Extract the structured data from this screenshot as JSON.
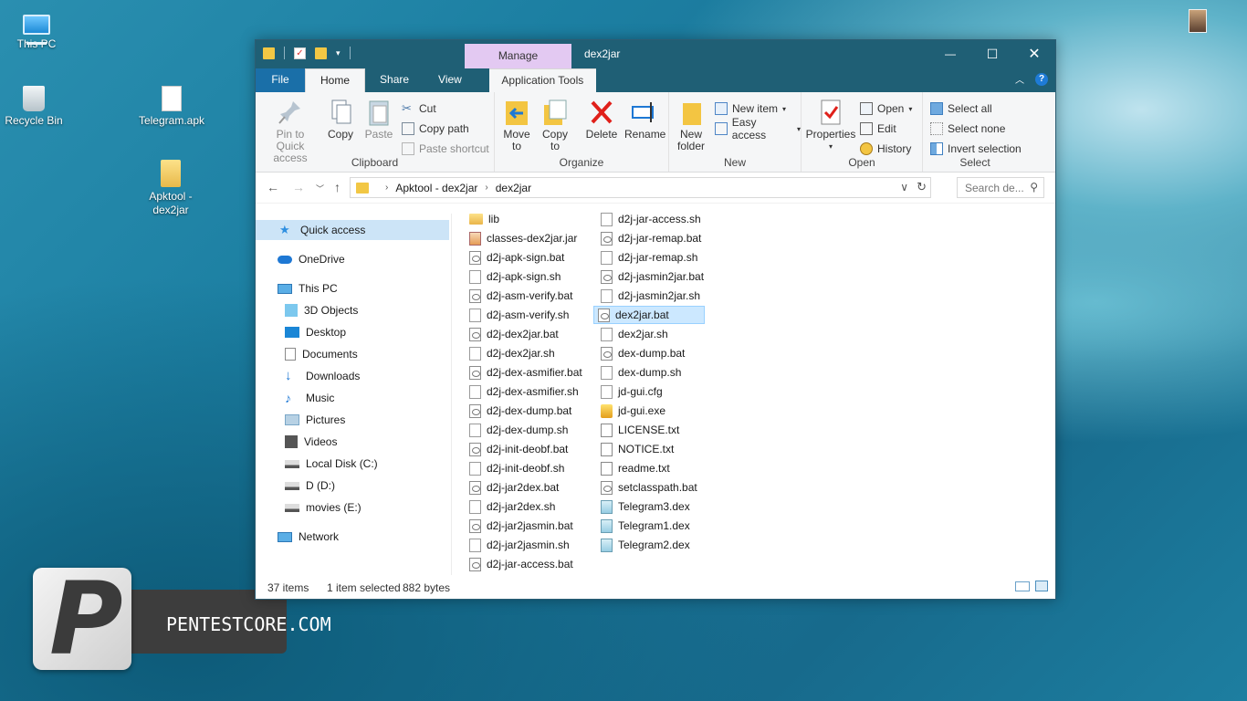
{
  "desktop": {
    "icons": [
      {
        "label": "This PC"
      },
      {
        "label": "Recycle Bin"
      },
      {
        "label": "Telegram.apk"
      },
      {
        "label": "Apktool - dex2jar"
      }
    ],
    "logo_text": "PENTESTCORE.COM",
    "logo_letter": "P"
  },
  "window": {
    "title": "dex2jar",
    "manage_tab": "Manage",
    "controls": {
      "minimize": "—",
      "maximize": "☐",
      "close": "✕"
    }
  },
  "tabs": {
    "file": "File",
    "home": "Home",
    "share": "Share",
    "view": "View",
    "app_tools": "Application Tools"
  },
  "ribbon": {
    "clipboard": {
      "label": "Clipboard",
      "pin": "Pin to Quick access",
      "copy": "Copy",
      "paste": "Paste",
      "cut": "Cut",
      "copy_path": "Copy path",
      "paste_shortcut": "Paste shortcut"
    },
    "organize": {
      "label": "Organize",
      "move_to": "Move to",
      "copy_to": "Copy to",
      "delete": "Delete",
      "rename": "Rename"
    },
    "new": {
      "label": "New",
      "new_folder": "New folder",
      "new_item": "New item",
      "easy_access": "Easy access"
    },
    "open": {
      "label": "Open",
      "properties": "Properties",
      "open": "Open",
      "edit": "Edit",
      "history": "History"
    },
    "select": {
      "label": "Select",
      "select_all": "Select all",
      "select_none": "Select none",
      "invert": "Invert selection"
    }
  },
  "address": {
    "crumbs": [
      "Apktool - dex2jar",
      "dex2jar"
    ],
    "search_placeholder": "Search de..."
  },
  "nav": [
    {
      "label": "Quick access",
      "icon": "star-icon",
      "color": "#2f8fe0"
    },
    {
      "label": "OneDrive",
      "icon": "cloud-icon",
      "color": "#1e78d4"
    },
    {
      "label": "This PC",
      "icon": "computer-icon",
      "color": "#3a9ae0"
    },
    {
      "label": "3D Objects",
      "icon": "cube-icon",
      "color": "#4fb4e8"
    },
    {
      "label": "Desktop",
      "icon": "desktop-icon",
      "color": "#1a86d6"
    },
    {
      "label": "Documents",
      "icon": "document-icon",
      "color": "#8a8a8a"
    },
    {
      "label": "Downloads",
      "icon": "download-icon",
      "color": "#1e78d4"
    },
    {
      "label": "Music",
      "icon": "music-icon",
      "color": "#1e78d4"
    },
    {
      "label": "Pictures",
      "icon": "pictures-icon",
      "color": "#7aa7c8"
    },
    {
      "label": "Videos",
      "icon": "film-icon",
      "color": "#555555"
    },
    {
      "label": "Local Disk (C:)",
      "icon": "drive-icon",
      "color": "#777777"
    },
    {
      "label": "D (D:)",
      "icon": "drive-icon",
      "color": "#777777"
    },
    {
      "label": "movies (E:)",
      "icon": "drive-icon",
      "color": "#777777"
    },
    {
      "label": "Network",
      "icon": "network-icon",
      "color": "#2f8fe0"
    }
  ],
  "files_col1": [
    {
      "name": "lib",
      "type": "folder"
    },
    {
      "name": "classes-dex2jar.jar",
      "type": "jar"
    },
    {
      "name": "d2j-apk-sign.bat",
      "type": "bat"
    },
    {
      "name": "d2j-apk-sign.sh",
      "type": "doc"
    },
    {
      "name": "d2j-asm-verify.bat",
      "type": "bat"
    },
    {
      "name": "d2j-asm-verify.sh",
      "type": "doc"
    },
    {
      "name": "d2j-dex2jar.bat",
      "type": "bat"
    },
    {
      "name": "d2j-dex2jar.sh",
      "type": "doc"
    },
    {
      "name": "d2j-dex-asmifier.bat",
      "type": "bat"
    },
    {
      "name": "d2j-dex-asmifier.sh",
      "type": "doc"
    },
    {
      "name": "d2j-dex-dump.bat",
      "type": "bat"
    },
    {
      "name": "d2j-dex-dump.sh",
      "type": "doc"
    },
    {
      "name": "d2j-init-deobf.bat",
      "type": "bat"
    },
    {
      "name": "d2j-init-deobf.sh",
      "type": "doc"
    },
    {
      "name": "d2j-jar2dex.bat",
      "type": "bat"
    },
    {
      "name": "d2j-jar2dex.sh",
      "type": "doc"
    },
    {
      "name": "d2j-jar2jasmin.bat",
      "type": "bat"
    },
    {
      "name": "d2j-jar2jasmin.sh",
      "type": "doc"
    },
    {
      "name": "d2j-jar-access.bat",
      "type": "bat"
    }
  ],
  "files_col2": [
    {
      "name": "d2j-jar-access.sh",
      "type": "doc"
    },
    {
      "name": "d2j-jar-remap.bat",
      "type": "bat"
    },
    {
      "name": "d2j-jar-remap.sh",
      "type": "doc"
    },
    {
      "name": "d2j-jasmin2jar.bat",
      "type": "bat"
    },
    {
      "name": "d2j-jasmin2jar.sh",
      "type": "doc"
    },
    {
      "name": "dex2jar.bat",
      "type": "bat",
      "selected": true
    },
    {
      "name": "dex2jar.sh",
      "type": "doc"
    },
    {
      "name": "dex-dump.bat",
      "type": "bat"
    },
    {
      "name": "dex-dump.sh",
      "type": "doc"
    },
    {
      "name": "jd-gui.cfg",
      "type": "doc"
    },
    {
      "name": "jd-gui.exe",
      "type": "exe"
    },
    {
      "name": "LICENSE.txt",
      "type": "txt"
    },
    {
      "name": "NOTICE.txt",
      "type": "txt"
    },
    {
      "name": "readme.txt",
      "type": "txt"
    },
    {
      "name": "setclasspath.bat",
      "type": "bat"
    },
    {
      "name": "Telegram3.dex",
      "type": "dex"
    },
    {
      "name": "Telegram1.dex",
      "type": "dex"
    },
    {
      "name": "Telegram2.dex",
      "type": "dex"
    }
  ],
  "status": {
    "items": "37 items",
    "selected": "1 item selected",
    "size": "882 bytes"
  },
  "colors": {
    "titlebar": "#1f5f75",
    "manage": "#e3c9f2",
    "selection": "#cce8ff",
    "file_tab": "#1a6fa8"
  }
}
